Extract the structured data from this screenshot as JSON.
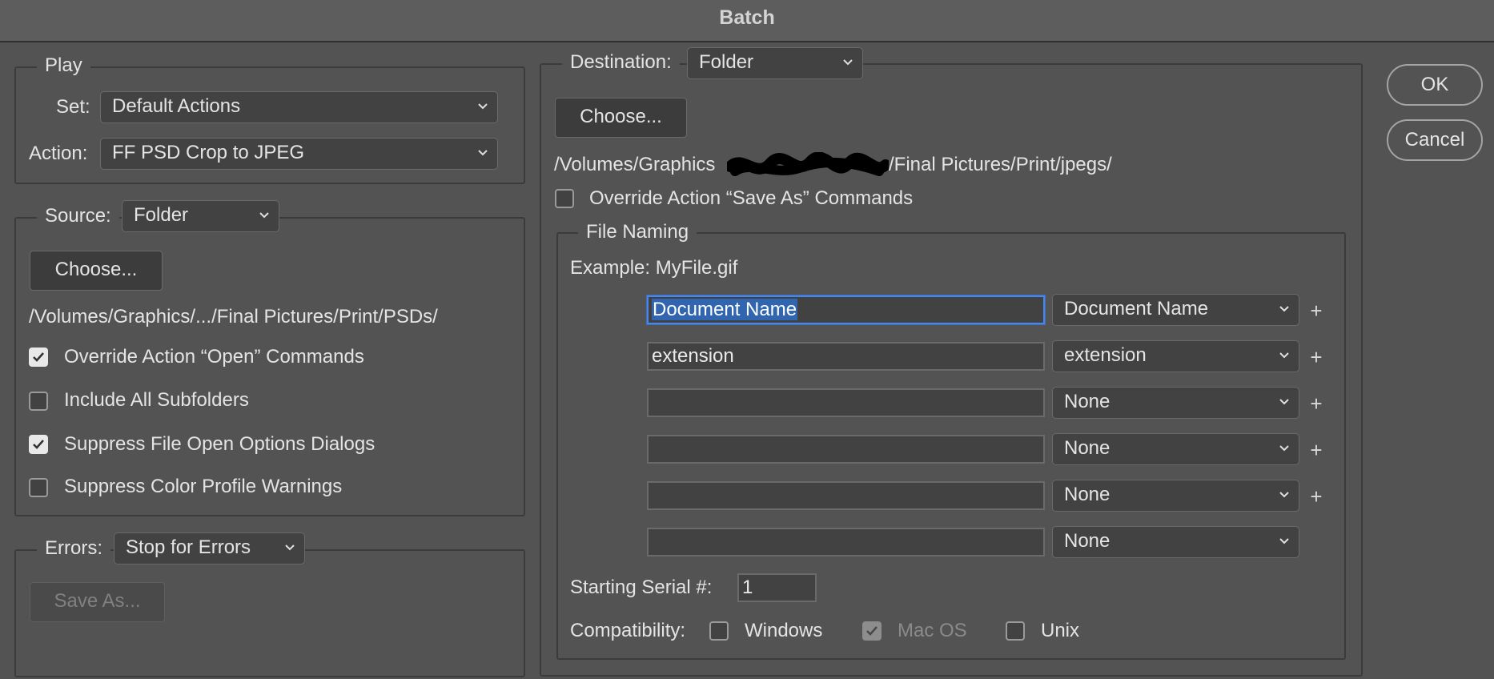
{
  "window": {
    "title": "Batch"
  },
  "play": {
    "legend": "Play",
    "set_label": "Set:",
    "set_value": "Default Actions",
    "action_label": "Action:",
    "action_value": "FF PSD Crop to JPEG"
  },
  "source": {
    "label": "Source:",
    "value": "Folder",
    "choose_label": "Choose...",
    "path": "/Volumes/Graphics/.../Final Pictures/Print/PSDs/",
    "options": [
      {
        "label": "Override Action “Open” Commands",
        "checked": true
      },
      {
        "label": "Include All Subfolders",
        "checked": false
      },
      {
        "label": "Suppress File Open Options Dialogs",
        "checked": true
      },
      {
        "label": "Suppress Color Profile Warnings",
        "checked": false
      }
    ]
  },
  "errors": {
    "label": "Errors:",
    "value": "Stop for Errors",
    "save_as_label": "Save As..."
  },
  "destination": {
    "label": "Destination:",
    "value": "Folder",
    "choose_label": "Choose...",
    "path_start": "/Volumes/Graphics",
    "path_end": "/Final Pictures/Print/jpegs/",
    "override_label": "Override Action “Save As” Commands"
  },
  "file_naming": {
    "legend": "File Naming",
    "example": "Example: MyFile.gif",
    "rows": [
      {
        "text": "Document Name",
        "select": "Document Name",
        "plus": "+"
      },
      {
        "text": "extension",
        "select": "extension",
        "plus": "+"
      },
      {
        "text": "",
        "select": "None",
        "plus": "+"
      },
      {
        "text": "",
        "select": "None",
        "plus": "+"
      },
      {
        "text": "",
        "select": "None",
        "plus": "+"
      },
      {
        "text": "",
        "select": "None",
        "plus": ""
      }
    ],
    "serial_label": "Starting Serial #:",
    "serial_value": "1",
    "compat_label": "Compatibility:",
    "compat": [
      {
        "label": "Windows",
        "checked": false,
        "enabled": true
      },
      {
        "label": "Mac OS",
        "checked": true,
        "enabled": false
      },
      {
        "label": "Unix",
        "checked": false,
        "enabled": true
      }
    ]
  },
  "buttons": {
    "ok": "OK",
    "cancel": "Cancel"
  },
  "colors": {
    "background": "#535353",
    "field": "#424242",
    "focus": "#4a86e8",
    "selection": "#3165b0"
  }
}
